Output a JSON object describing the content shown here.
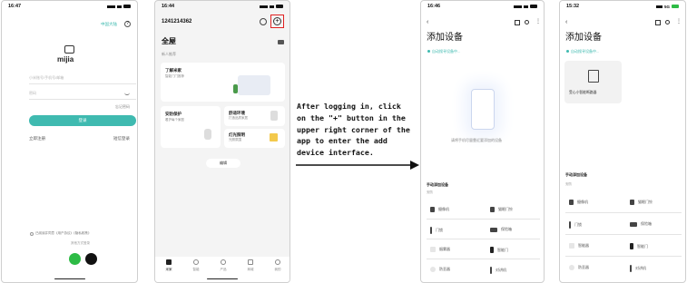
{
  "phone1": {
    "time": "16:47",
    "region": "中国大陆",
    "logo": "mijia",
    "account_ph": "小米账号/手机号/邮箱",
    "password_ph": "密码",
    "forgot": "忘记密码",
    "login": "登录",
    "register": "立即注册",
    "sms_login": "短信登录",
    "agree": "已阅读并同意《用户协议》《隐私政策》",
    "other": "其他方式登录"
  },
  "phone2": {
    "time": "16:44",
    "user": "1241214362",
    "home": "全屋",
    "device_count": "新人推荐",
    "banner_title": "了解米家",
    "banner_sub": "智能门门推荐",
    "security_title": "安防保护",
    "security_sub": "看护每个家庭",
    "comfort_title": "舒适环境",
    "comfort_sub": "打造品质家居",
    "lighting_title": "灯光照明",
    "lighting_sub": "光照氛围",
    "more": "编辑",
    "tabs": [
      "米家",
      "智能",
      "产品",
      "商城",
      "我的"
    ]
  },
  "instruction": "After logging in, click on the \"+\" button in the upper right corner of the app to enter the add device interface.",
  "phone3": {
    "time": "16:46",
    "title": "添加设备",
    "scanning": "自动搜寻设备中...",
    "hint": "请将手机尽量靠近要添加的设备",
    "manual": "手动添加设备",
    "category": "安防",
    "devices": [
      "摄像机",
      "猫眼门铃",
      "门锁",
      "保险箱",
      "烟雾器",
      "智能门",
      "防丢器",
      "对讲机"
    ]
  },
  "phone4": {
    "time": "15:32",
    "network": "5G",
    "title": "添加设备",
    "scanning": "自动搜寻设备中...",
    "found": "受心小智能断路器",
    "manual": "手动添加设备",
    "category": "安防",
    "devices": [
      "摄像机",
      "猫眼门铃",
      "门锁",
      "保险箱",
      "智能器",
      "智能门",
      "防丢器",
      "对讲机"
    ]
  },
  "colors": {
    "accent": "#3fbab0",
    "highlight": "#e02020"
  }
}
